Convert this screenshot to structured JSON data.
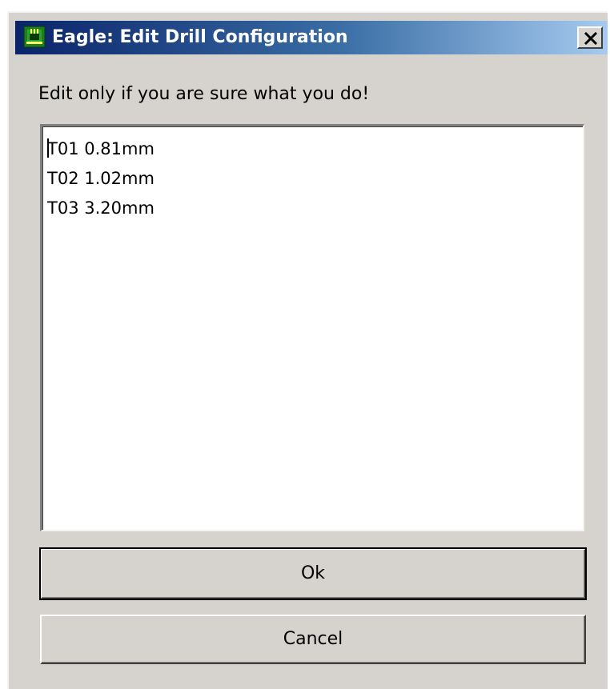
{
  "window": {
    "title": "Eagle: Edit Drill Configuration",
    "app_icon": "eagle-pcb-icon",
    "close_icon": "close-icon",
    "titlebar_color": "#0a246a"
  },
  "dialog": {
    "warning": "Edit only if you are sure what you do!",
    "editor_lines": [
      "T01 0.81mm",
      "T02 1.02mm",
      "T03 3.20mm"
    ],
    "ok_label": "Ok",
    "cancel_label": "Cancel"
  }
}
